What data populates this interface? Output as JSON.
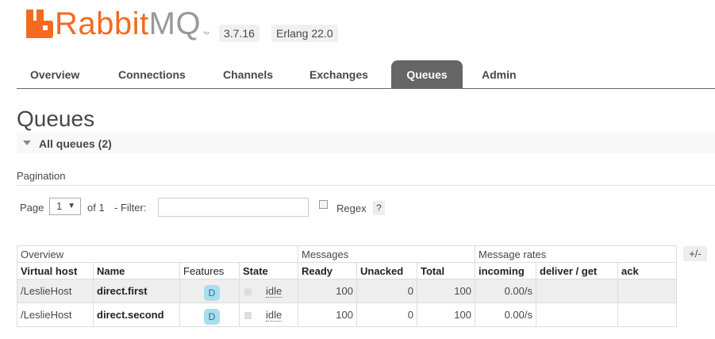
{
  "header": {
    "logo_rabbit": "Rabbit",
    "logo_mq": "MQ",
    "logo_tm": "™",
    "version": "3.7.16",
    "erlang": "Erlang 22.0"
  },
  "tabs": [
    {
      "label": "Overview"
    },
    {
      "label": "Connections"
    },
    {
      "label": "Channels"
    },
    {
      "label": "Exchanges"
    },
    {
      "label": "Queues",
      "active": true
    },
    {
      "label": "Admin"
    }
  ],
  "page_title": "Queues",
  "section": {
    "label": "All queues (2)"
  },
  "pagination": {
    "heading": "Pagination",
    "page_label": "Page",
    "page_value": "1",
    "of_label": "of 1",
    "filter_label": "- Filter:",
    "filter_value": "",
    "regex_label": "Regex",
    "help": "?"
  },
  "table": {
    "group_headers": [
      "Overview",
      "Messages",
      "Message rates"
    ],
    "columns": [
      "Virtual host",
      "Name",
      "Features",
      "State",
      "Ready",
      "Unacked",
      "Total",
      "incoming",
      "deliver / get",
      "ack"
    ],
    "toggle": "+/-",
    "rows": [
      {
        "vhost": "/LeslieHost",
        "name": "direct.first",
        "feature": "D",
        "state": "idle",
        "ready": "100",
        "unacked": "0",
        "total": "100",
        "incoming": "0.00/s",
        "deliver": "",
        "ack": ""
      },
      {
        "vhost": "/LeslieHost",
        "name": "direct.second",
        "feature": "D",
        "state": "idle",
        "ready": "100",
        "unacked": "0",
        "total": "100",
        "incoming": "0.00/s",
        "deliver": "",
        "ack": ""
      }
    ]
  },
  "colors": {
    "brand": "#f26b21",
    "tab_active_bg": "#666666",
    "badge_bg": "#aaddee"
  }
}
